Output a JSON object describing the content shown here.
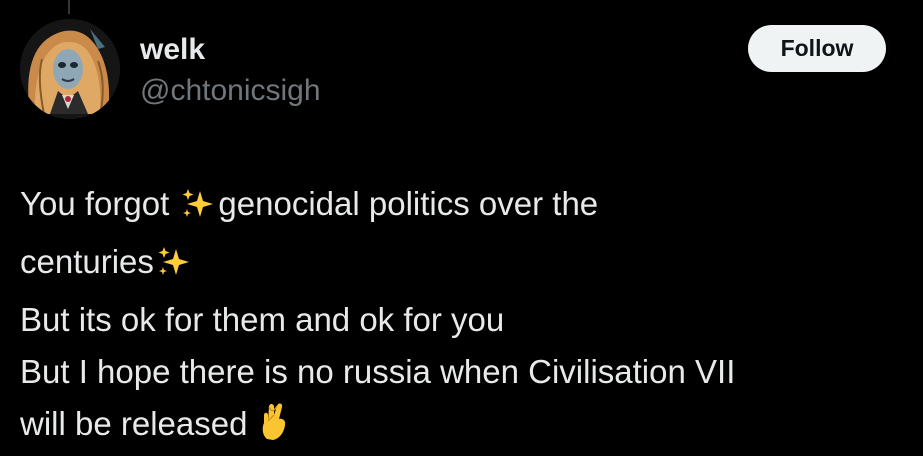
{
  "author": {
    "display_name": "welk",
    "handle": "@chtonicsigh",
    "avatar_icon": "gothic-vampire-portrait-avatar"
  },
  "follow_button": {
    "label": "Follow"
  },
  "tweet": {
    "line1_before": "You forgot ",
    "line1_emoji": "sparkles-icon",
    "line1_after": "genocidal politics over the",
    "line2_text": "centuries",
    "line2_emoji": "sparkles-icon",
    "line3_text": "But its ok for them and ok for you",
    "line4_text": "But I hope there is no russia when Civilisation VII",
    "line5_text": "will be released ",
    "line5_emoji": "crossed-fingers-icon"
  },
  "colors": {
    "background": "#000000",
    "primary_text": "#e7e9ea",
    "secondary_text": "#71767b",
    "follow_bg": "#eff3f4",
    "follow_text": "#0f1419",
    "sparkle": "#ffcc3a",
    "hand": "#fbc531"
  }
}
